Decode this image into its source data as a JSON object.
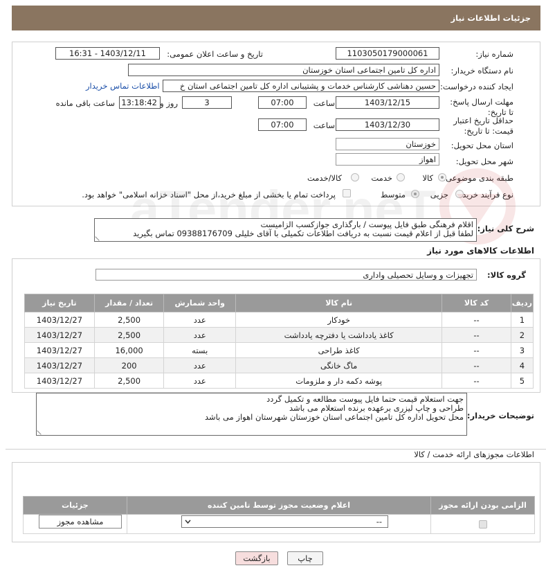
{
  "header": {
    "title": "جزئیات اطلاعات نیاز"
  },
  "form": {
    "need_number_label": "شماره نیاز:",
    "need_number": "1103050179000061",
    "announce_label": "تاریخ و ساعت اعلان عمومی:",
    "announce_value": "1403/12/11 - 16:31",
    "buyer_label": "نام دستگاه خریدار:",
    "buyer_value": "اداره کل تامین اجتماعی استان خوزستان",
    "creator_label": "ایجاد کننده درخواست:",
    "creator_value": "حسین دهناشی کارشناس خدمات و پشتیبانی اداره کل تامین اجتماعی استان خ",
    "contact_link": "اطلاعات تماس خریدار",
    "deadline_label": "مهلت ارسال پاسخ: تا تاریخ:",
    "deadline_date": "1403/12/15",
    "time_label": "ساعت",
    "deadline_time": "07:00",
    "days_value": "3",
    "days_label": "روز و",
    "remaining_time": "13:18:42",
    "remaining_label": "ساعت باقی مانده",
    "validity_label": "حداقل تاریخ اعتبار قیمت: تا تاریخ:",
    "validity_date": "1403/12/30",
    "validity_time": "07:00",
    "province_label": "استان محل تحویل:",
    "province_value": "خوزستان",
    "city_label": "شهر محل تحویل:",
    "city_value": "اهواز",
    "category_label": "طبقه بندی موضوعی:",
    "category_options": [
      "کالا",
      "خدمت",
      "کالا/خدمت"
    ],
    "purchase_label": "نوع فرآیند خرید :",
    "purchase_options": [
      "جزیی",
      "متوسط"
    ],
    "payment_note": "پرداخت تمام یا بخشی از مبلغ خرید،از محل \"اسناد خزانه اسلامی\" خواهد بود."
  },
  "description": {
    "label": "شرح کلی نیاز:",
    "line1": "اقلام فرهنگی طبق فایل پیوست / بارگذاری جوازکسب الزامیست",
    "line2": "لطفا قبل از اعلام قیمت نسبت به دریافت اطلاعات تکمیلی با آقای خلیلی 09388176709 تماس بگیرید"
  },
  "goods": {
    "section_title": "اطلاعات کالاهای مورد نیاز",
    "group_label": "گروه کالا:",
    "group_value": "تجهیزات و وسایل تحصیلی واداری",
    "headers": [
      "ردیف",
      "کد کالا",
      "نام کالا",
      "واحد شمارش",
      "تعداد / مقدار",
      "تاریخ نیاز"
    ],
    "rows": [
      [
        "1",
        "--",
        "خودکار",
        "عدد",
        "2,500",
        "1403/12/27"
      ],
      [
        "2",
        "--",
        "کاغذ یادداشت یا دفترچه یادداشت",
        "عدد",
        "2,500",
        "1403/12/27"
      ],
      [
        "3",
        "--",
        "کاغذ طراحی",
        "بسته",
        "16,000",
        "1403/12/27"
      ],
      [
        "4",
        "--",
        "ماگ خانگی",
        "عدد",
        "200",
        "1403/12/27"
      ],
      [
        "5",
        "--",
        "پوشه دکمه دار و ملزومات",
        "عدد",
        "2,500",
        "1403/12/27"
      ]
    ]
  },
  "buyer_notes": {
    "label": "توضیحات خریدار:",
    "line1": "جهت استعلام قیمت حتما فایل پیوست مطالعه و تکمیل گردد",
    "line2": "طراحی و چاپ لیزری برعهده برنده استعلام می باشد",
    "line3": "محل تحویل اداره کل تامین اجتماعی استان خوزستان شهرستان اهواز می باشد"
  },
  "permits": {
    "section_title": "اطلاعات مجوزهای ارائه خدمت / کالا",
    "headers": [
      "الزامی بودن ارائه مجوز",
      "اعلام وضعیت مجوز توسط تامین کننده",
      "جزئیات"
    ],
    "select_value": "--",
    "view_button": "مشاهده مجوز"
  },
  "footer": {
    "print_button": "چاپ",
    "back_button": "بازگشت"
  },
  "watermark_text": "PariaTender.neT",
  "colors": {
    "header_bg": "#8a7560",
    "table_header_bg": "#9a9a9a",
    "link": "#1a4ea8"
  }
}
